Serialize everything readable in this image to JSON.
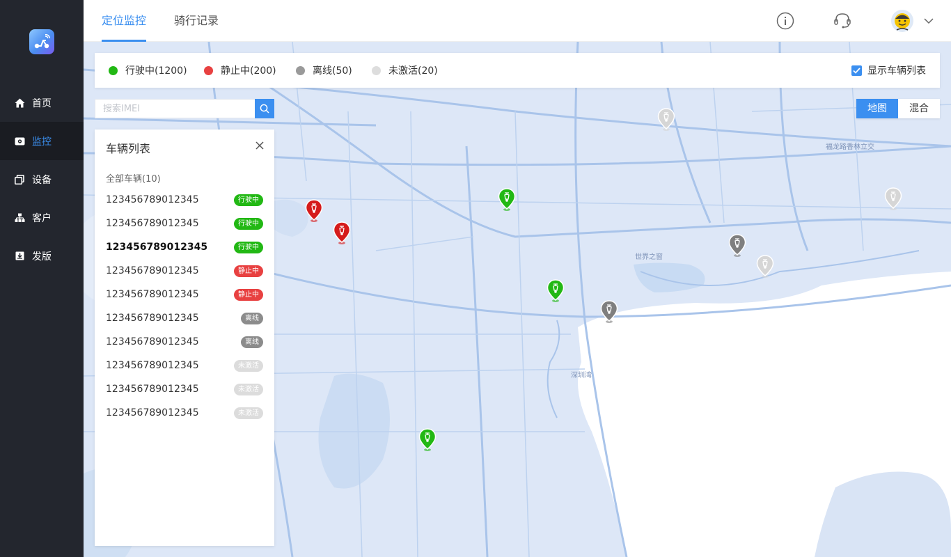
{
  "sidebar": {
    "items": [
      {
        "label": "首页",
        "icon": "home-icon"
      },
      {
        "label": "监控",
        "icon": "eye-icon"
      },
      {
        "label": "设备",
        "icon": "devices-icon"
      },
      {
        "label": "客户",
        "icon": "org-icon"
      },
      {
        "label": "发版",
        "icon": "release-icon"
      }
    ],
    "active": "监控"
  },
  "header": {
    "tabs": [
      {
        "label": "定位监控"
      },
      {
        "label": "骑行记录"
      }
    ],
    "active_tab": "定位监控"
  },
  "legend": {
    "moving": {
      "label": "行驶中(1200)",
      "color": "#22b814"
    },
    "stopped": {
      "label": "静止中(200)",
      "color": "#e84141"
    },
    "offline": {
      "label": "离线(50)",
      "color": "#9a9a9a"
    },
    "inactive": {
      "label": "未激活(20)",
      "color": "#dddddd"
    },
    "show_list_label": "显示车辆列表",
    "show_list_checked": true
  },
  "search": {
    "placeholder": "搜索IMEI",
    "value": ""
  },
  "map_type": {
    "options": [
      "地图",
      "混合"
    ],
    "selected": "地图"
  },
  "vehicle_panel": {
    "title": "车辆列表",
    "all_label": "全部车辆(10)",
    "rows": [
      {
        "id": "123456789012345",
        "status": "行驶中",
        "color": "#22b814"
      },
      {
        "id": "123456789012345",
        "status": "行驶中",
        "color": "#22b814"
      },
      {
        "id": "123456789012345",
        "status": "行驶中",
        "color": "#22b814",
        "selected": true
      },
      {
        "id": "123456789012345",
        "status": "静止中",
        "color": "#e84141"
      },
      {
        "id": "123456789012345",
        "status": "静止中",
        "color": "#e84141"
      },
      {
        "id": "123456789012345",
        "status": "离线",
        "color": "#8c8c8c"
      },
      {
        "id": "123456789012345",
        "status": "离线",
        "color": "#8c8c8c"
      },
      {
        "id": "123456789012345",
        "status": "未激活",
        "color": "#dcdcdc"
      },
      {
        "id": "123456789012345",
        "status": "未激活",
        "color": "#dcdcdc"
      },
      {
        "id": "123456789012345",
        "status": "未激活",
        "color": "#dcdcdc"
      }
    ]
  },
  "map": {
    "labels": [
      "福龙路香林立交",
      "世界之窗",
      "深圳湾"
    ]
  }
}
